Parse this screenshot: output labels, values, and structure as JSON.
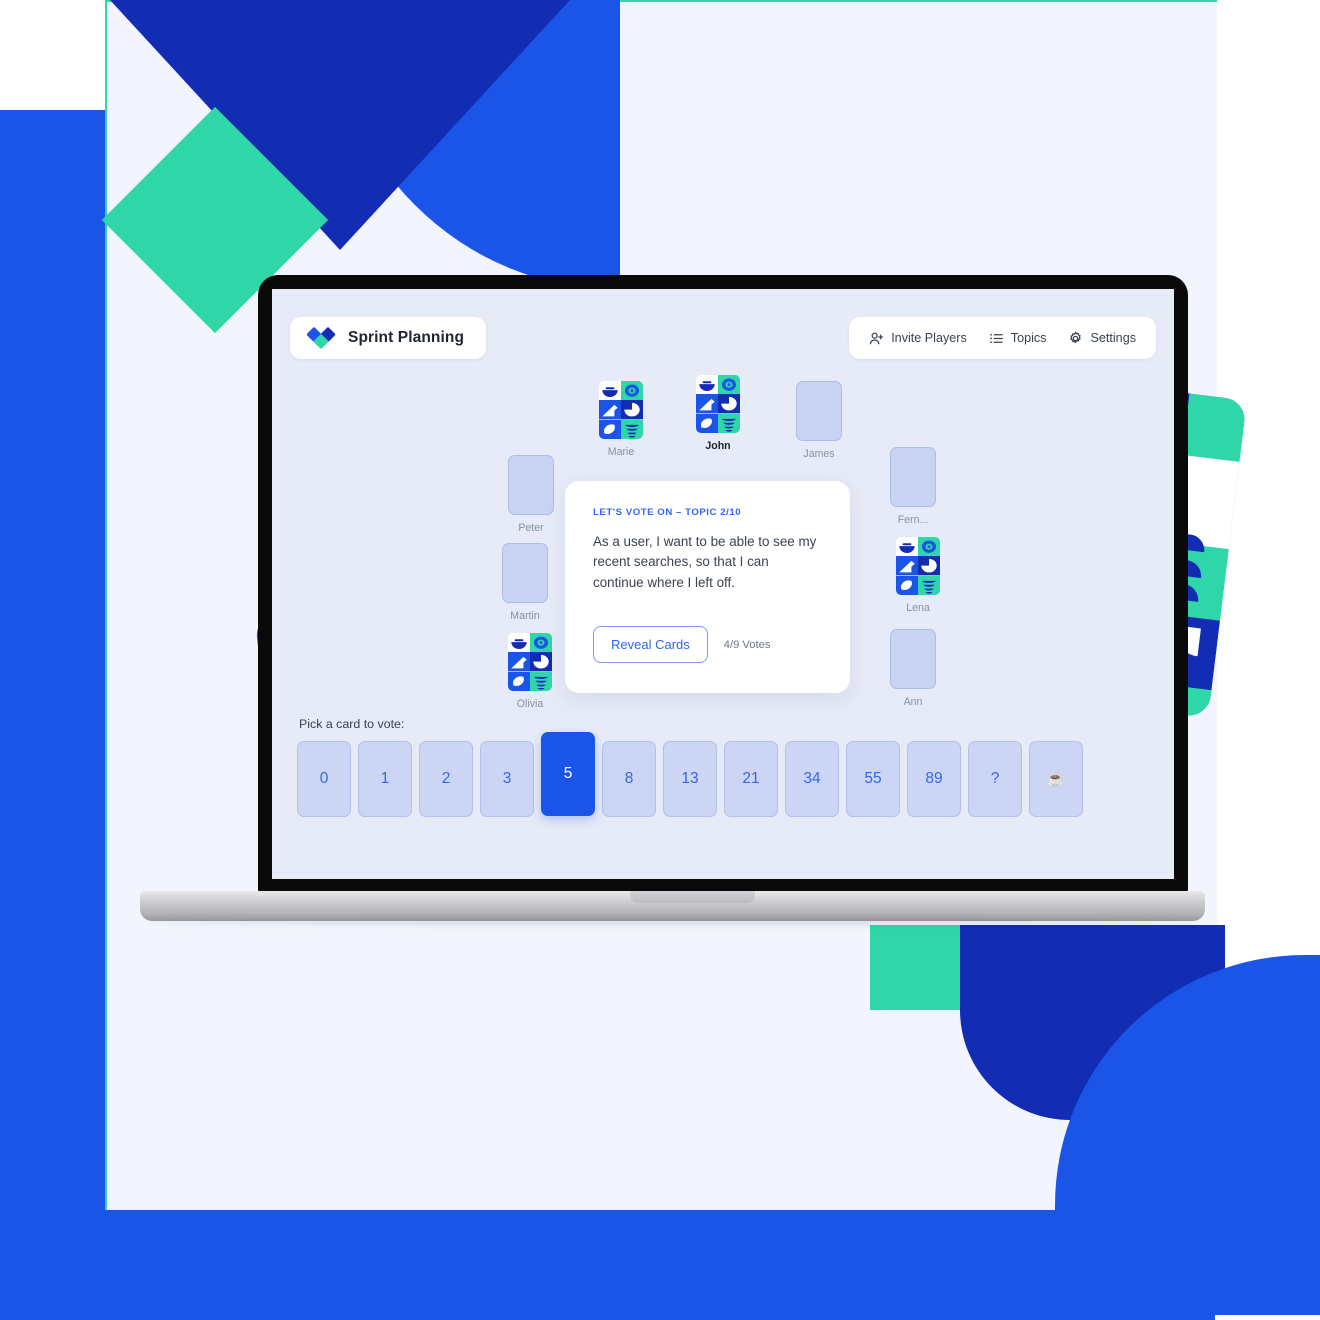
{
  "app": {
    "logo_icon": "diamond-heart-logo-icon",
    "title": "Sprint Planning"
  },
  "nav": {
    "items": [
      {
        "label": "Invite Players",
        "icon": "person-add-icon"
      },
      {
        "label": "Topics",
        "icon": "list-icon"
      },
      {
        "label": "Settings",
        "icon": "gear-icon"
      }
    ]
  },
  "topic": {
    "kicker": "LET'S VOTE ON – TOPIC 2/10",
    "text": "As a user, I want to be able to see my recent searches, so that I can continue where I left off.",
    "reveal_label": "Reveal Cards",
    "votes": "4/9 Votes"
  },
  "deck": {
    "label": "Pick a card to vote:",
    "selected": "5",
    "cards": [
      "0",
      "1",
      "2",
      "3",
      "5",
      "8",
      "13",
      "21",
      "34",
      "55",
      "89",
      "?",
      "☕"
    ]
  },
  "players": {
    "top": [
      {
        "name": "Marie",
        "voted": true,
        "is_me": false
      },
      {
        "name": "John",
        "voted": true,
        "is_me": true
      },
      {
        "name": "James",
        "voted": false,
        "is_me": false
      }
    ],
    "left": [
      {
        "name": "Peter",
        "voted": false,
        "is_me": false
      },
      {
        "name": "Martin",
        "voted": false,
        "is_me": false
      },
      {
        "name": "Olivia",
        "voted": true,
        "is_me": false
      }
    ],
    "right": [
      {
        "name": "Fern...",
        "voted": false,
        "is_me": false
      },
      {
        "name": "Lena",
        "voted": true,
        "is_me": false
      },
      {
        "name": "Ann",
        "voted": false,
        "is_me": false
      }
    ]
  },
  "colors": {
    "brand_blue": "#1b55e8",
    "brand_navy": "#132cb4",
    "brand_teal": "#2ed6a8",
    "accent_link": "#3466ea",
    "app_bg": "#e7ebf7",
    "card_face": "#ccd6f4",
    "page_bg": "#f2f5fd"
  }
}
